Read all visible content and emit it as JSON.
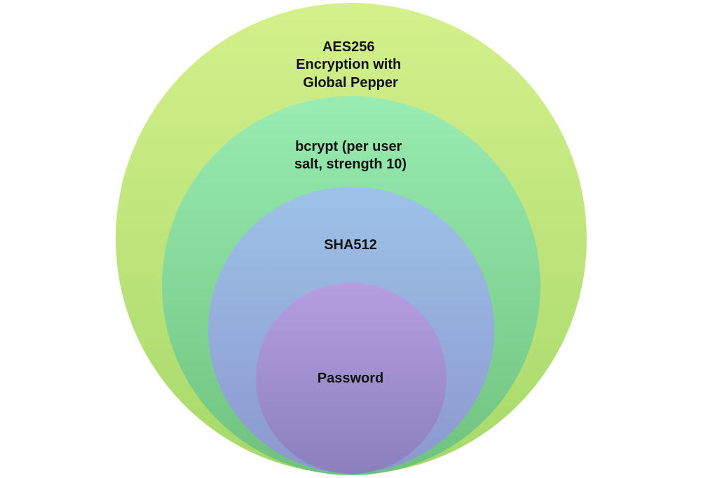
{
  "diagram": {
    "type": "nested-circles",
    "layers": [
      {
        "id": "aes",
        "label_lines": [
          "AES256",
          "Encryption with",
          "Global Pepper"
        ],
        "color_top": "#d5f08c",
        "color_bottom": "#a6d96a"
      },
      {
        "id": "bcrypt",
        "label_lines": [
          "bcrypt (per user",
          "salt, strength 10)"
        ],
        "color_top": "#99ecb2",
        "color_bottom": "#6fc27d"
      },
      {
        "id": "sha512",
        "label_lines": [
          "SHA512"
        ],
        "color_top": "#9dc3e7",
        "color_bottom": "#8c97d0"
      },
      {
        "id": "password",
        "label_lines": [
          "Password"
        ],
        "color_top": "#b69ee0",
        "color_bottom": "#8a80bd"
      }
    ]
  }
}
